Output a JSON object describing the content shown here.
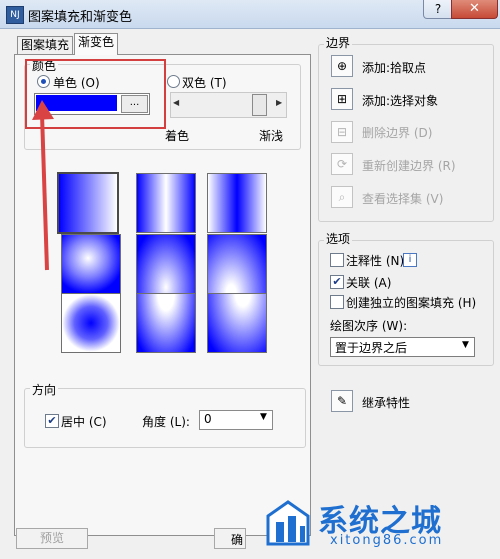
{
  "window": {
    "title": "图案填充和渐变色",
    "icon_text": "NJ",
    "help": "?",
    "close": "✕"
  },
  "tabs": [
    {
      "label": "图案填充"
    },
    {
      "label": "渐变色"
    }
  ],
  "color": {
    "title": "颜色",
    "single_label": "单色",
    "single_key": "(O)",
    "double_label": "双色",
    "double_key": "(T)",
    "swatch_color": "#0000FF",
    "browse": "...",
    "shade_label": "着色",
    "tint_label": "渐浅",
    "slider_value": 0.82
  },
  "direction": {
    "title": "方向",
    "center_label": "居中",
    "center_key": "(C)",
    "center_checked": true,
    "angle_label": "角度",
    "angle_key": "(L):",
    "angle_value": "0"
  },
  "boundary": {
    "title": "边界",
    "items": [
      {
        "label": "添加:拾取点",
        "icon": "pick-points-icon",
        "enabled": true
      },
      {
        "label": "添加:选择对象",
        "icon": "select-objects-icon",
        "enabled": true
      },
      {
        "label": "删除边界",
        "key": "(D)",
        "icon": "remove-boundary-icon",
        "enabled": false
      },
      {
        "label": "重新创建边界",
        "key": "(R)",
        "icon": "recreate-boundary-icon",
        "enabled": false
      },
      {
        "label": "查看选择集",
        "key": "(V)",
        "icon": "view-selection-icon",
        "enabled": false
      }
    ]
  },
  "options": {
    "title": "选项",
    "annotative": {
      "label": "注释性",
      "key": "(N)",
      "checked": false
    },
    "associative": {
      "label": "关联",
      "key": "(A)",
      "checked": true
    },
    "separate": {
      "label": "创建独立的图案填充",
      "key": "(H)",
      "checked": false
    },
    "draw_order_label": "绘图次序",
    "draw_order_key": "(W):",
    "draw_order_value": "置于边界之后"
  },
  "inherit": {
    "label": "继承特性",
    "icon": "inherit-properties-icon"
  },
  "footer": {
    "preview_label": "预览",
    "ok_label": "确"
  },
  "watermark": {
    "text": "系统之城",
    "url": "xitong86.com"
  }
}
